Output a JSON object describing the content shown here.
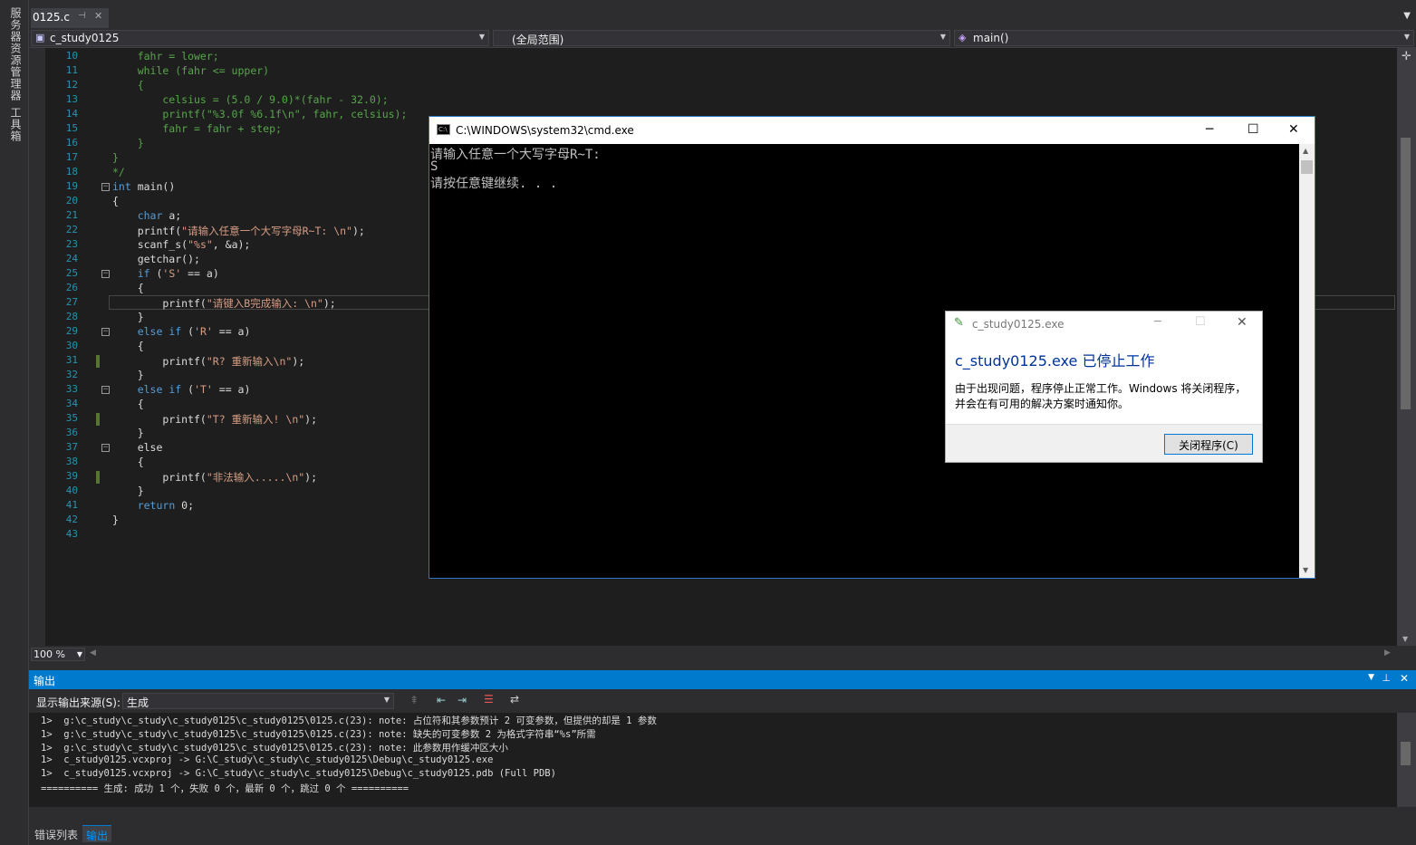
{
  "side_tabs": [
    "服务器资源管理器",
    "工具箱"
  ],
  "doc_tab": {
    "title": "0125.c",
    "pin": "⊣",
    "close": "✕"
  },
  "nav": {
    "project": "c_study0125",
    "scope": "(全局范围)",
    "member": "main()"
  },
  "code_lines": [
    {
      "n": "10",
      "t": "    fahr = lower;"
    },
    {
      "n": "11",
      "t": "    while (fahr <= upper)"
    },
    {
      "n": "12",
      "t": "    {"
    },
    {
      "n": "13",
      "t": "        celsius = (5.0 / 9.0)*(fahr - 32.0);"
    },
    {
      "n": "14",
      "t": "        printf(\"%3.0f %6.1f\\n\", fahr, celsius);"
    },
    {
      "n": "15",
      "t": "        fahr = fahr + step;"
    },
    {
      "n": "16",
      "t": "    }"
    },
    {
      "n": "17",
      "t": "}"
    },
    {
      "n": "18",
      "t": "*/"
    },
    {
      "n": "19",
      "t": "int main()"
    },
    {
      "n": "20",
      "t": "{"
    },
    {
      "n": "21",
      "t": "    char a;"
    },
    {
      "n": "22",
      "t": "    printf(\"请输入任意一个大写字母R~T: \\n\");"
    },
    {
      "n": "23",
      "t": "    scanf_s(\"%s\", &a);"
    },
    {
      "n": "24",
      "t": "    getchar();"
    },
    {
      "n": "25",
      "t": "    if ('S' == a)"
    },
    {
      "n": "26",
      "t": "    {"
    },
    {
      "n": "27",
      "t": "        printf(\"请键入B完成输入: \\n\");"
    },
    {
      "n": "28",
      "t": "    }"
    },
    {
      "n": "29",
      "t": "    else if ('R' == a)"
    },
    {
      "n": "30",
      "t": "    {"
    },
    {
      "n": "31",
      "t": "        printf(\"R? 重新输入\\n\");"
    },
    {
      "n": "32",
      "t": "    }"
    },
    {
      "n": "33",
      "t": "    else if ('T' == a)"
    },
    {
      "n": "34",
      "t": "    {"
    },
    {
      "n": "35",
      "t": "        printf(\"T? 重新输入! \\n\");"
    },
    {
      "n": "36",
      "t": "    }"
    },
    {
      "n": "37",
      "t": "    else"
    },
    {
      "n": "38",
      "t": "    {"
    },
    {
      "n": "39",
      "t": "        printf(\"非法输入.....\\n\");"
    },
    {
      "n": "40",
      "t": "    }"
    },
    {
      "n": "41",
      "t": "    return 0;"
    },
    {
      "n": "42",
      "t": "}"
    },
    {
      "n": "43",
      "t": ""
    }
  ],
  "zoom": "100 %",
  "output": {
    "title": "输出",
    "source_label": "显示输出来源(S):",
    "source_value": "生成",
    "lines": [
      "1>  g:\\c_study\\c_study\\c_study0125\\c_study0125\\0125.c(23): note: 占位符和其参数预计 2 可变参数，但提供的却是 1 参数",
      "1>  g:\\c_study\\c_study\\c_study0125\\c_study0125\\0125.c(23): note: 缺失的可变参数 2 为格式字符串“%s”所需",
      "1>  g:\\c_study\\c_study\\c_study0125\\c_study0125\\0125.c(23): note: 此参数用作缓冲区大小",
      "1>  c_study0125.vcxproj -> G:\\C_study\\c_study\\c_study0125\\Debug\\c_study0125.exe",
      "1>  c_study0125.vcxproj -> G:\\C_study\\c_study\\c_study0125\\Debug\\c_study0125.pdb (Full PDB)",
      "========== 生成: 成功 1 个，失败 0 个，最新 0 个，跳过 0 个 =========="
    ]
  },
  "bottom_tabs": [
    "错误列表",
    "输出"
  ],
  "cmd": {
    "title": "C:\\WINDOWS\\system32\\cmd.exe",
    "lines": [
      "请输入任意一个大写字母R~T:",
      "S",
      "请按任意键继续. . ."
    ]
  },
  "dialog": {
    "title": "c_study0125.exe",
    "heading": "c_study0125.exe 已停止工作",
    "body1": "由于出现问题，程序停止正常工作。Windows 将关闭程序，",
    "body2": "并会在有可用的解决方案时通知你。",
    "button": "关闭程序(C)"
  },
  "colors": {
    "accent": "#007acc",
    "editor_bg": "#1e1e1e",
    "comment": "#57a64a",
    "keyword": "#569cd6",
    "string": "#d69d85"
  }
}
